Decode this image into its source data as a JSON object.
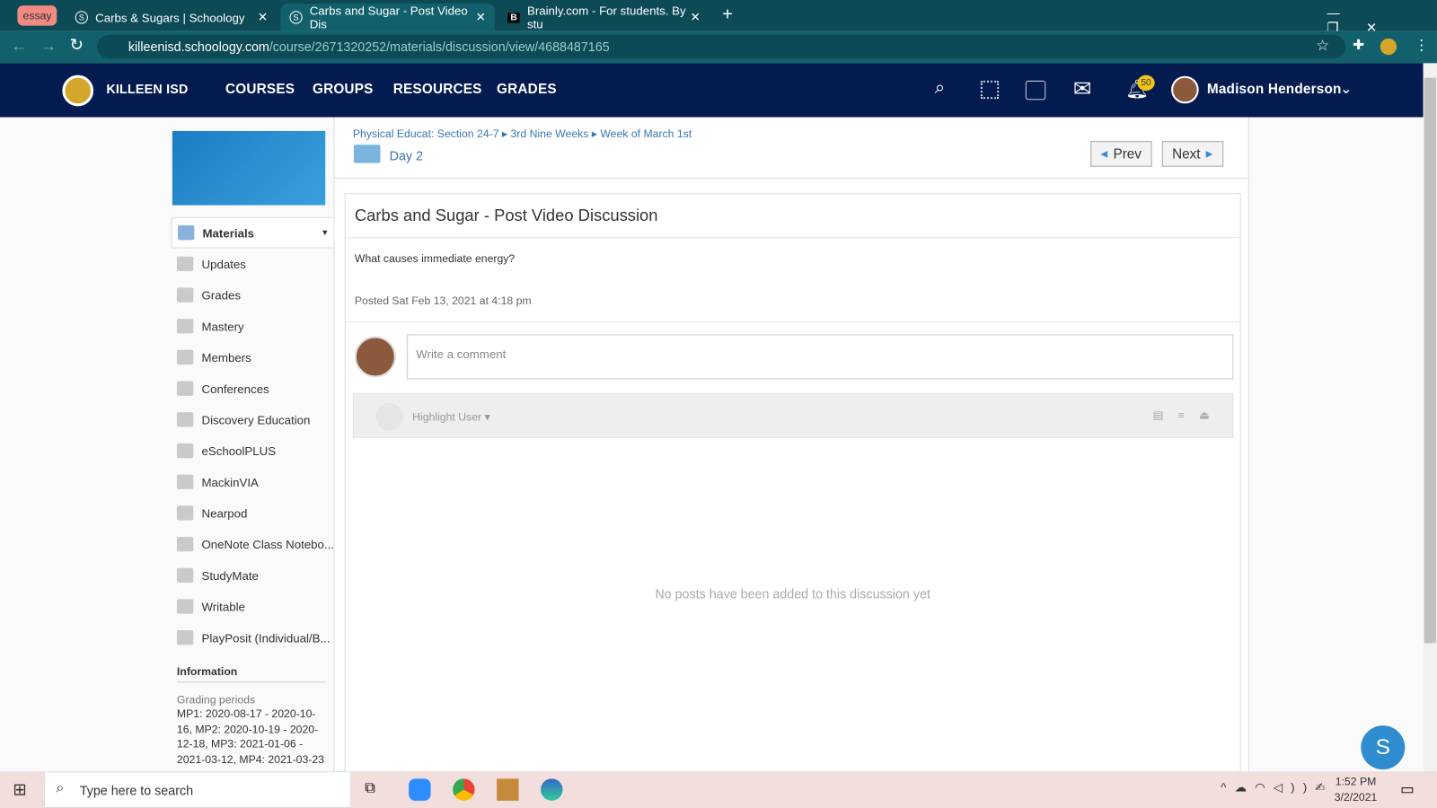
{
  "browser": {
    "tabs": [
      {
        "label": "essay"
      },
      {
        "label": "Carbs & Sugars | Schoology"
      },
      {
        "label": "Carbs and Sugar - Post Video Dis"
      },
      {
        "label": "Brainly.com - For students. By stu"
      }
    ],
    "url_domain": "killeenisd.schoology.com",
    "url_path": "/course/2671320252/materials/discussion/view/4688487165"
  },
  "nav": {
    "brand": "KILLEEN ISD",
    "links": [
      "COURSES",
      "GROUPS",
      "RESOURCES",
      "GRADES"
    ],
    "notifications": "50",
    "user": "Madison Henderson"
  },
  "sidebar": {
    "materials": "Materials",
    "items": [
      "Updates",
      "Grades",
      "Mastery",
      "Members",
      "Conferences",
      "Discovery Education",
      "eSchoolPLUS",
      "MackinVIA",
      "Nearpod",
      "OneNote Class Notebo...",
      "StudyMate",
      "Writable",
      "PlayPosit (Individual/B..."
    ],
    "info_title": "Information",
    "grading_label": "Grading periods",
    "grading_value": "MP1: 2020-08-17 - 2020-10-16, MP2: 2020-10-19 - 2020-12-18, MP3: 2021-01-06 - 2021-03-12, MP4: 2021-03-23"
  },
  "breadcrumb": [
    "Physical Educat: Section 24-7",
    "3rd Nine Weeks",
    "Week of March 1st"
  ],
  "folder": "Day 2",
  "prev": "Prev",
  "next": "Next",
  "discussion": {
    "title": "Carbs and Sugar - Post Video Discussion",
    "body": "What causes immediate energy?",
    "posted": "Posted Sat Feb 13, 2021 at 4:18 pm",
    "comment_placeholder": "Write a comment",
    "highlight": "Highlight User",
    "empty": "No posts have been added to this discussion yet"
  },
  "taskbar": {
    "search": "Type here to search",
    "time": "1:52 PM",
    "date": "3/2/2021"
  }
}
